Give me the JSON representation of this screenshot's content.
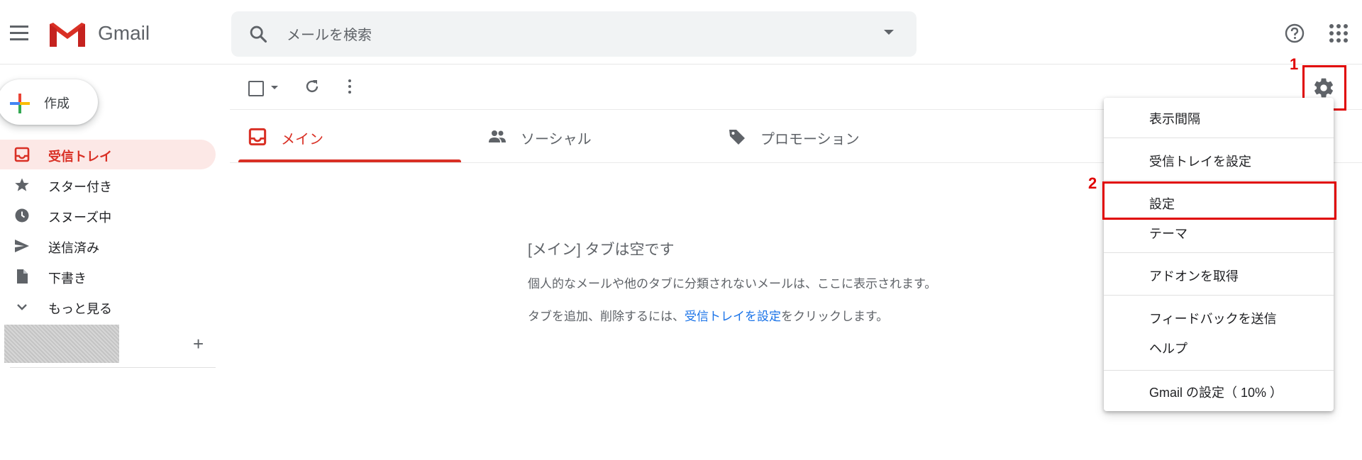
{
  "header": {
    "app_name": "Gmail",
    "search_placeholder": "メールを検索"
  },
  "sidebar": {
    "compose_label": "作成",
    "items": [
      {
        "label": "受信トレイ",
        "icon": "inbox-icon",
        "active": true
      },
      {
        "label": "スター付き",
        "icon": "star-icon"
      },
      {
        "label": "スヌーズ中",
        "icon": "clock-icon"
      },
      {
        "label": "送信済み",
        "icon": "send-icon"
      },
      {
        "label": "下書き",
        "icon": "draft-icon"
      },
      {
        "label": "もっと見る",
        "icon": "chevron-down-icon"
      }
    ],
    "add_label": "+"
  },
  "tabs": [
    {
      "label": "メイン",
      "icon": "inbox-icon",
      "active": true
    },
    {
      "label": "ソーシャル",
      "icon": "people-icon"
    },
    {
      "label": "プロモーション",
      "icon": "tag-icon"
    }
  ],
  "empty_state": {
    "title": "[メイン] タブは空です",
    "description": "個人的なメールや他のタブに分類されないメールは、ここに表示されます。",
    "hint_before": "タブを追加、削除するには、",
    "hint_link": "受信トレイを設定",
    "hint_after": "をクリックします。"
  },
  "settings_menu": {
    "items": [
      {
        "label": "表示間隔"
      },
      {
        "label": "受信トレイを設定"
      },
      {
        "label": "設定",
        "highlighted": true
      },
      {
        "label": "テーマ"
      },
      {
        "label": "アドオンを取得"
      },
      {
        "label": "フィードバックを送信"
      },
      {
        "label": "ヘルプ"
      },
      {
        "label": "Gmail の設定（ 10% ）"
      }
    ]
  },
  "annotations": {
    "step1": "1",
    "step2": "2",
    "color": "#e00000"
  },
  "colors": {
    "accent_red": "#d93025",
    "active_bg": "#fce8e6",
    "link_blue": "#1a73e8"
  }
}
